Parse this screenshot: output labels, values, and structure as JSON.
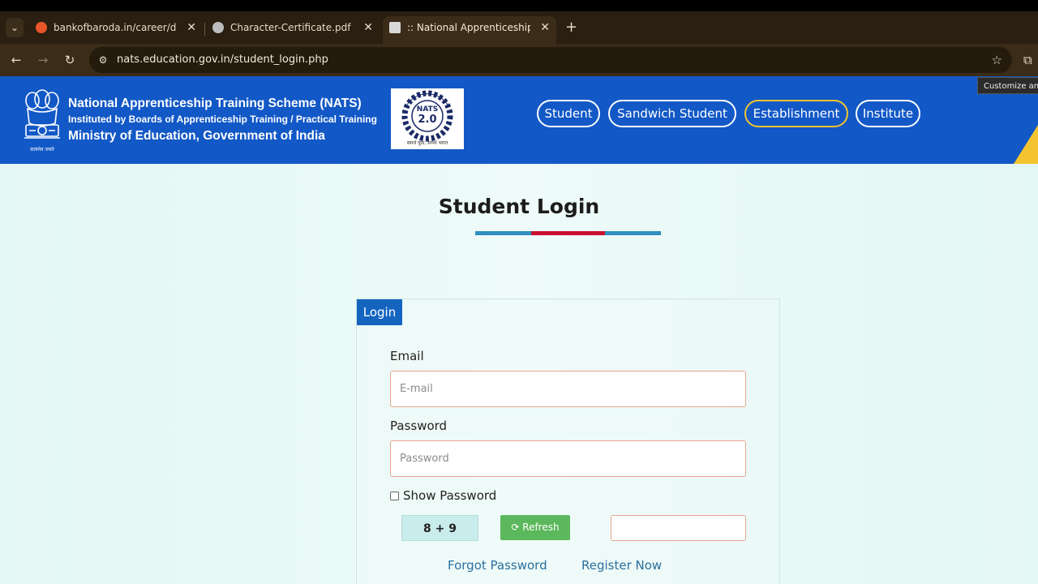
{
  "browser": {
    "tabs": [
      {
        "title": "bankofbaroda.in/career/downlo",
        "favicon_color": "#e8562a"
      },
      {
        "title": "Character-Certificate.pdf",
        "favicon_color": "#c9c9c9"
      },
      {
        "title": ":: National Apprenticeship Train",
        "favicon_color": "#d9d9d9"
      }
    ],
    "url": "nats.education.gov.in/student_login.php",
    "tooltip": "Customize and control Google Chrome"
  },
  "site": {
    "title_line1": "National Apprenticeship Training Scheme (NATS)",
    "title_line2": "Instituted by Boards of Apprenticeship Training / Practical Training",
    "title_line3": "Ministry of Education, Government of India",
    "emblem_motto": "सत्यमेव जयते",
    "logo_text": "NATS",
    "logo_version": "2.0",
    "logo_tagline": "समर्थ युवा, समर्थ भारत",
    "nav": [
      {
        "label": "Student"
      },
      {
        "label": "Sandwich Student"
      },
      {
        "label": "Establishment"
      },
      {
        "label": "Institute"
      }
    ],
    "colors": {
      "header": "#1258c6",
      "accent": "#f4c430",
      "underline_blue": "#2f8fc2",
      "underline_red": "#c8102e"
    }
  },
  "page": {
    "title": "Student Login",
    "login_tab": "Login",
    "email_label": "Email",
    "email_placeholder": "E-mail",
    "password_label": "Password",
    "password_placeholder": "Password",
    "show_password": "Show Password",
    "captcha": "8 + 9",
    "refresh": "Refresh",
    "forgot_password": "Forgot Password",
    "register_now": "Register Now"
  }
}
